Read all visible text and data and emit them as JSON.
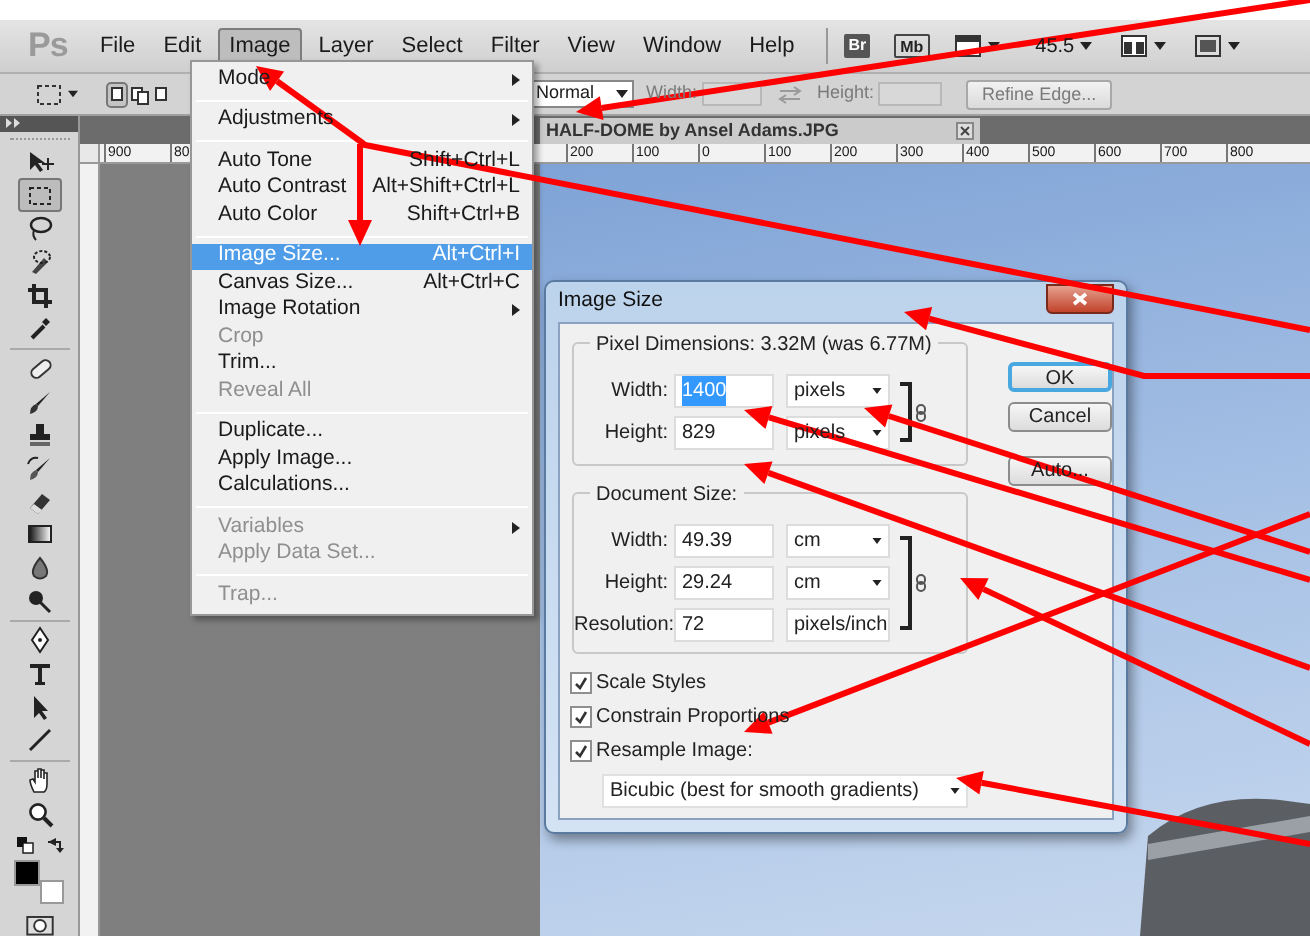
{
  "app_logo": "Ps",
  "menubar": {
    "items": [
      {
        "label": "File",
        "selected": false
      },
      {
        "label": "Edit",
        "selected": false
      },
      {
        "label": "Image",
        "selected": true
      },
      {
        "label": "Layer",
        "selected": false
      },
      {
        "label": "Select",
        "selected": false
      },
      {
        "label": "Filter",
        "selected": false
      },
      {
        "label": "View",
        "selected": false
      },
      {
        "label": "Window",
        "selected": false
      },
      {
        "label": "Help",
        "selected": false
      }
    ],
    "launch_buttons": [
      "Br",
      "Mb"
    ],
    "zoom": "45.5"
  },
  "options_bar": {
    "style": "Normal",
    "width_label": "Width:",
    "height_label": "Height:",
    "size_disabled": true,
    "refine_button": {
      "label": "Refine Edge...",
      "disabled": true
    }
  },
  "toolbox": {
    "tools": [
      {
        "selected": false
      },
      {
        "selected": true
      },
      {
        "selected": false
      },
      {
        "selected": false
      },
      {
        "selected": false
      },
      {
        "selected": false
      },
      {
        "selected": false
      },
      {
        "selected": false
      },
      {
        "selected": false
      },
      {
        "selected": false
      },
      {
        "selected": false
      },
      {
        "selected": false
      },
      {
        "selected": false
      },
      {
        "selected": false
      },
      {
        "selected": false
      },
      {
        "selected": false
      },
      {
        "selected": false
      },
      {
        "selected": false
      },
      {
        "selected": false
      },
      {
        "selected": false
      }
    ]
  },
  "document": {
    "tab_title": "HALF-DOME by Ansel Adams.JPG",
    "ruler_left_labels": [
      "900",
      "80"
    ],
    "ruler_labels": [
      "200",
      "100",
      "0",
      "100",
      "200",
      "300",
      "400",
      "500",
      "600",
      "700",
      "800"
    ]
  },
  "image_menu": {
    "items": [
      {
        "kind": "item",
        "label": "Mode",
        "submenu": true,
        "disabled": false,
        "selected": false
      },
      {
        "kind": "separator"
      },
      {
        "kind": "item",
        "label": "Adjustments",
        "submenu": true,
        "disabled": false,
        "selected": false
      },
      {
        "kind": "separator"
      },
      {
        "kind": "item",
        "label": "Auto Tone",
        "shortcut": "Shift+Ctrl+L",
        "submenu": false,
        "disabled": false,
        "selected": false
      },
      {
        "kind": "item",
        "label": "Auto Contrast",
        "shortcut": "Alt+Shift+Ctrl+L",
        "submenu": false,
        "disabled": false,
        "selected": false
      },
      {
        "kind": "item",
        "label": "Auto Color",
        "shortcut": "Shift+Ctrl+B",
        "submenu": false,
        "disabled": false,
        "selected": false
      },
      {
        "kind": "separator"
      },
      {
        "kind": "item",
        "label": "Image Size...",
        "shortcut": "Alt+Ctrl+I",
        "submenu": false,
        "disabled": false,
        "selected": true
      },
      {
        "kind": "item",
        "label": "Canvas Size...",
        "shortcut": "Alt+Ctrl+C",
        "submenu": false,
        "disabled": false,
        "selected": false
      },
      {
        "kind": "item",
        "label": "Image Rotation",
        "submenu": true,
        "disabled": false,
        "selected": false
      },
      {
        "kind": "item",
        "label": "Crop",
        "submenu": false,
        "disabled": true,
        "selected": false
      },
      {
        "kind": "item",
        "label": "Trim...",
        "submenu": false,
        "disabled": false,
        "selected": false
      },
      {
        "kind": "item",
        "label": "Reveal All",
        "submenu": false,
        "disabled": true,
        "selected": false
      },
      {
        "kind": "separator"
      },
      {
        "kind": "item",
        "label": "Duplicate...",
        "submenu": false,
        "disabled": false,
        "selected": false
      },
      {
        "kind": "item",
        "label": "Apply Image...",
        "submenu": false,
        "disabled": false,
        "selected": false
      },
      {
        "kind": "item",
        "label": "Calculations...",
        "submenu": false,
        "disabled": false,
        "selected": false
      },
      {
        "kind": "separator"
      },
      {
        "kind": "item",
        "label": "Variables",
        "submenu": true,
        "disabled": true,
        "selected": false
      },
      {
        "kind": "item",
        "label": "Apply Data Set...",
        "submenu": false,
        "disabled": true,
        "selected": false
      },
      {
        "kind": "separator"
      },
      {
        "kind": "item",
        "label": "Trap...",
        "submenu": false,
        "disabled": true,
        "selected": false
      }
    ]
  },
  "dialog": {
    "title": "Image Size",
    "pixel_dimensions": {
      "legend": "Pixel Dimensions:  3.32M (was 6.77M)",
      "rows": [
        {
          "label": "Width:",
          "value": "1400",
          "unit": "pixels",
          "highlighted": true
        },
        {
          "label": "Height:",
          "value": "829",
          "unit": "pixels",
          "highlighted": false
        }
      ]
    },
    "document_size": {
      "legend": "Document Size:",
      "rows": [
        {
          "label": "Width:",
          "value": "49.39",
          "unit": "cm",
          "highlighted": false
        },
        {
          "label": "Height:",
          "value": "29.24",
          "unit": "cm",
          "highlighted": false
        },
        {
          "label": "Resolution:",
          "value": "72",
          "unit": "pixels/inch",
          "highlighted": false
        }
      ]
    },
    "checkboxes": [
      {
        "label": "Scale Styles",
        "checked": true
      },
      {
        "label": "Constrain Proportions",
        "checked": true
      },
      {
        "label": "Resample Image:",
        "checked": true
      }
    ],
    "resample_method": "Bicubic (best for smooth gradients)",
    "buttons": [
      {
        "label": "OK",
        "default": true
      },
      {
        "label": "Cancel",
        "default": false
      },
      {
        "label": "Auto...",
        "default": false
      }
    ]
  }
}
